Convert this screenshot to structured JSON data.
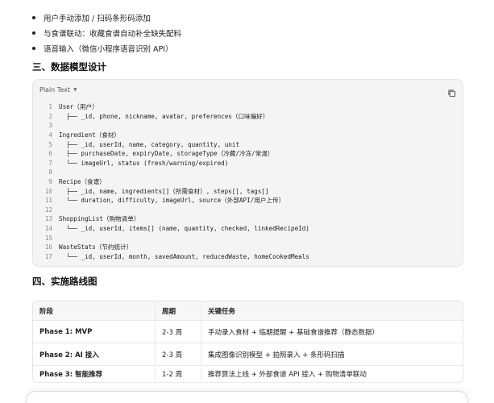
{
  "bullets": [
    "用户手动添加 / 扫码条形码添加",
    "与食谱联动：收藏食谱自动补全缺失配料",
    "语音输入（微信小程序语音识别 API）"
  ],
  "section3": {
    "title": "三、数据模型设计"
  },
  "code": {
    "language": "Plain Text",
    "lines": [
      {
        "n": "1",
        "t": "User（用户）"
      },
      {
        "n": "2",
        "t": "  ├── _id, phone, nickname, avatar, preferences（口味偏好）"
      },
      {
        "n": "3",
        "t": ""
      },
      {
        "n": "4",
        "t": "Ingredient（食材）"
      },
      {
        "n": "5",
        "t": "  ├── _id, userId, name, category, quantity, unit"
      },
      {
        "n": "6",
        "t": "  ├── purchaseDate, expiryDate, storageType（冷藏/冷冻/常温）"
      },
      {
        "n": "7",
        "t": "  └── imageUrl, status (fresh/warning/expired)"
      },
      {
        "n": "8",
        "t": ""
      },
      {
        "n": "9",
        "t": "Recipe（食谱）"
      },
      {
        "n": "10",
        "t": "  ├── _id, name, ingredients[]（所需食材）, steps[], tags[]"
      },
      {
        "n": "11",
        "t": "  └── duration, difficulty, imageUrl, source（外部API/用户上传）"
      },
      {
        "n": "12",
        "t": ""
      },
      {
        "n": "13",
        "t": "ShoppingList（购物清单）"
      },
      {
        "n": "14",
        "t": "  └── _id, userId, items[] (name, quantity, checked, linkedRecipeId)"
      },
      {
        "n": "15",
        "t": ""
      },
      {
        "n": "16",
        "t": "WasteStats（节约统计）"
      },
      {
        "n": "17",
        "t": "  └── _id, userId, month, savedAmount, reducedWaste, homeCookedMeals"
      }
    ]
  },
  "section4": {
    "title": "四、实施路线图"
  },
  "table": {
    "headers": [
      "阶段",
      "周期",
      "关键任务"
    ],
    "rows": [
      [
        "Phase 1: MVP",
        "2-3 周",
        "手动录入食材 + 临期提醒 + 基础食谱推荐（静态数据）"
      ],
      [
        "Phase 2: AI 接入",
        "2-3 周",
        "集成图像识别模型 + 拍照录入 + 条形码扫描"
      ],
      [
        "Phase 3: 智能推荐",
        "1-2 周",
        "推荐算法上线 + 外部食谱 API 接入 + 购物清单联动"
      ]
    ]
  }
}
